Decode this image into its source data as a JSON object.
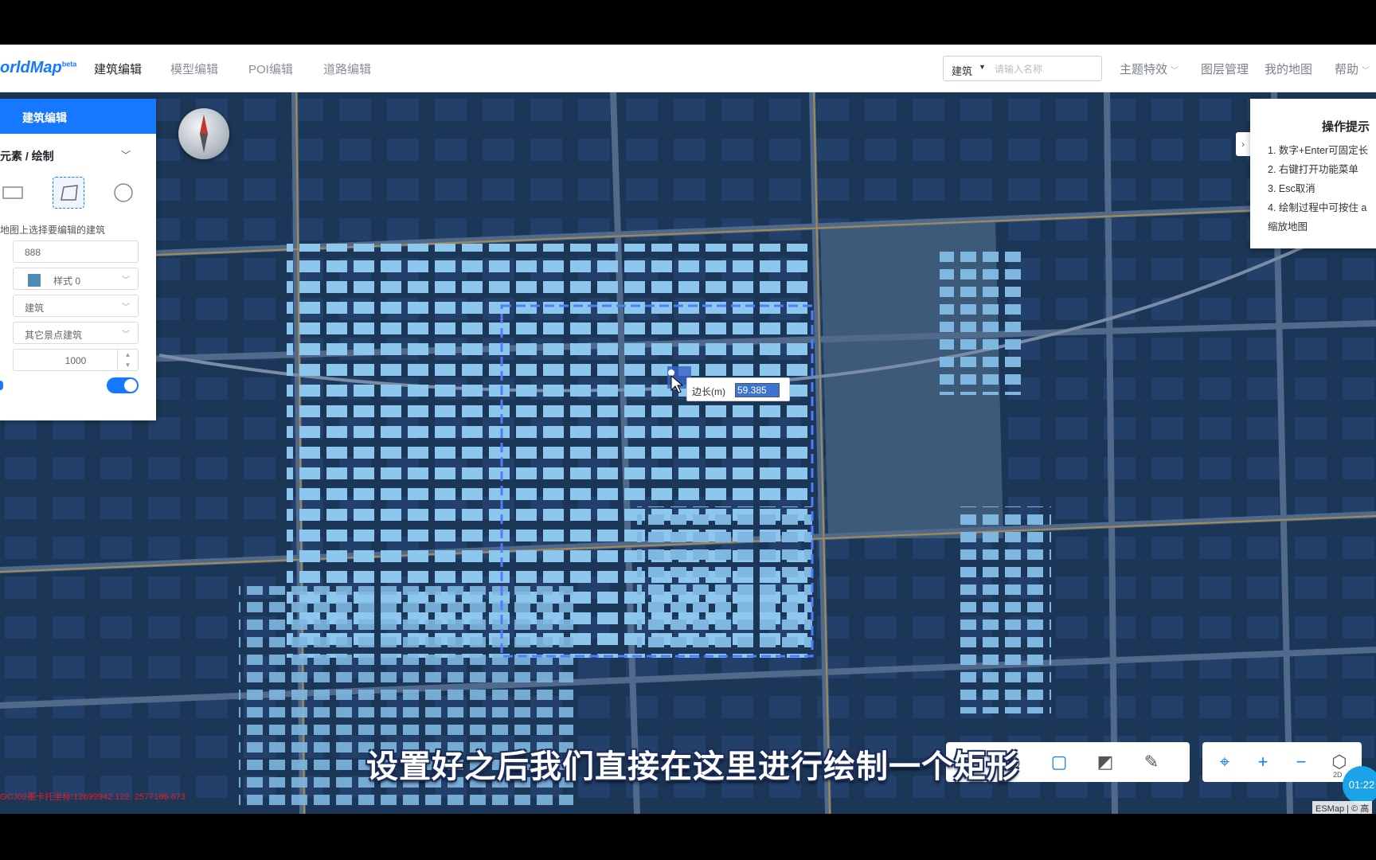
{
  "app": {
    "logo_text": "orldMap",
    "logo_sup": "beta"
  },
  "nav": {
    "tabs": [
      {
        "label": "建筑编辑",
        "active": true
      },
      {
        "label": "模型编辑",
        "active": false
      },
      {
        "label": "POI编辑",
        "active": false
      },
      {
        "label": "道路编辑",
        "active": false
      }
    ],
    "search": {
      "type": "建筑",
      "placeholder": "请输入名称"
    },
    "right_items": [
      "主题特效",
      "图层管理",
      "我的地图",
      "帮助"
    ]
  },
  "left_panel": {
    "title": "建筑编辑",
    "section": "元素 / 绘制",
    "hint": "地图上选择要编辑的建筑",
    "name_value": "888",
    "style_value": "样式 0",
    "category_value": "建筑",
    "subcategory_value": "其它景点建筑",
    "height_value": "1000",
    "toggle_on": true,
    "shapes": [
      "rectangle-icon",
      "polygon-icon",
      "circle-icon"
    ],
    "selected_shape": "polygon-icon"
  },
  "tips": {
    "title": "操作提示",
    "lines": [
      "1. 数字+Enter可固定长",
      "2. 右键打开功能菜单",
      "3. Esc取消",
      "4. 绘制过程中可按住 a",
      "缩放地图"
    ]
  },
  "edge_tooltip": {
    "label": "边长(m)",
    "value": "59.385"
  },
  "toolbar": {
    "left_icons": [
      "table-icon",
      "eye-icon",
      "square-icon",
      "map-edit-icon",
      "edit-icon"
    ],
    "right_icons": [
      "locate-icon",
      "zoom-in-icon",
      "zoom-out-icon",
      "3d-cube-icon"
    ],
    "cube_label": "2D"
  },
  "status": {
    "coordinates": "GCJ02墨卡托坐标:12699942.122, 2577186.673",
    "timer": "01:22",
    "attribution": "ESMap | © 高"
  },
  "subtitle": "设置好之后我们直接在这里进行绘制一个矩形",
  "colors": {
    "accent": "#1677ff",
    "map_background": "#1b3656",
    "building": "#8ec7ee"
  }
}
